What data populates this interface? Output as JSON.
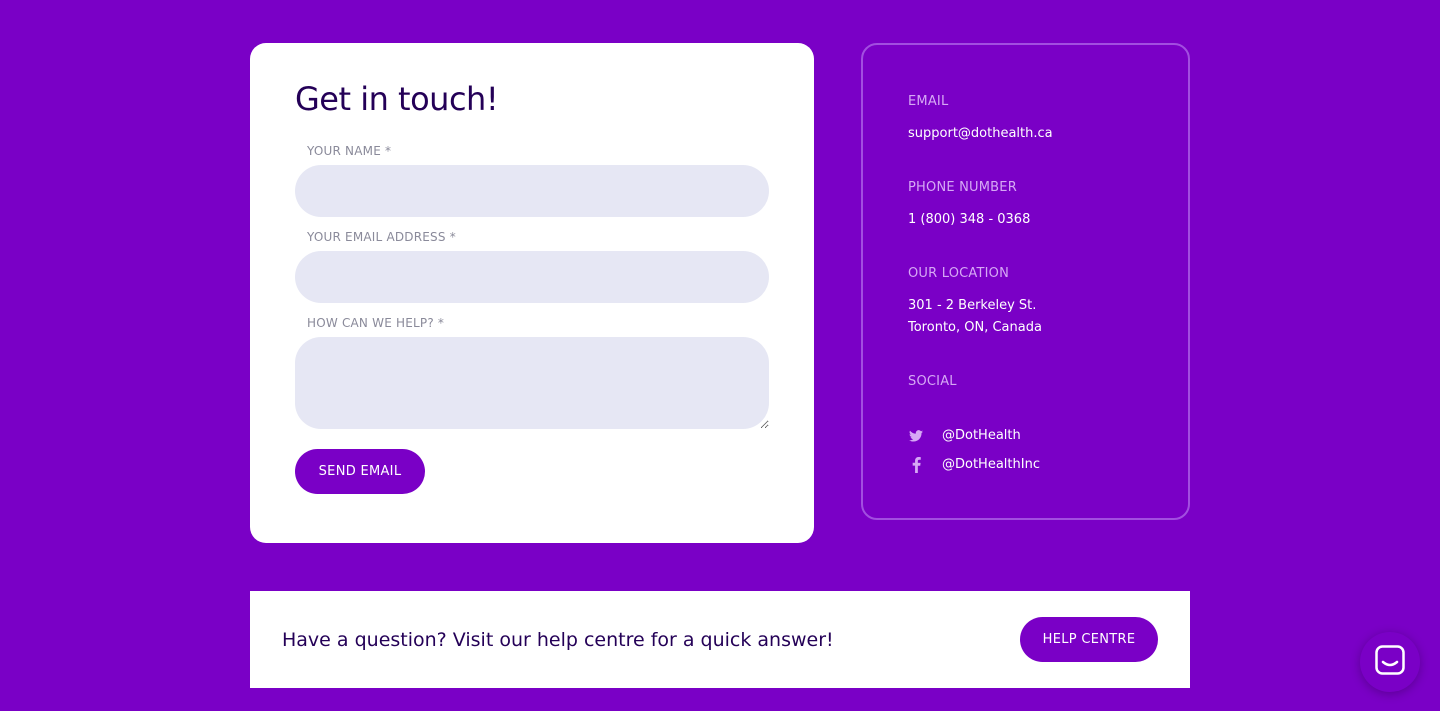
{
  "form": {
    "title": "Get in touch!",
    "name_label": "YOUR NAME *",
    "name_value": "",
    "email_label": "YOUR EMAIL ADDRESS *",
    "email_value": "",
    "help_label": "HOW CAN WE HELP? *",
    "help_value": "",
    "send_label": "SEND EMAIL"
  },
  "info": {
    "email_heading": "EMAIL",
    "email_value": "support@dothealth.ca",
    "phone_heading": "PHONE NUMBER",
    "phone_value": "1 (800) 348 - 0368",
    "location_heading": "OUR LOCATION",
    "location_line1": "301 - 2 Berkeley St.",
    "location_line2": "Toronto, ON, Canada",
    "social_heading": "SOCIAL",
    "social": [
      {
        "icon": "twitter-icon",
        "handle": "@DotHealth"
      },
      {
        "icon": "facebook-icon",
        "handle": "@DotHealthInc"
      }
    ]
  },
  "help_banner": {
    "text": "Have a question? Visit our help centre for a quick answer!",
    "button_label": "HELP CENTRE"
  },
  "chat": {
    "icon": "chat-icon"
  },
  "colors": {
    "background": "#7a00c6",
    "accent": "#7a00c6",
    "heading_dark": "#240057",
    "field_bg": "#e6e7f4",
    "info_heading": "#d6a8f5"
  }
}
